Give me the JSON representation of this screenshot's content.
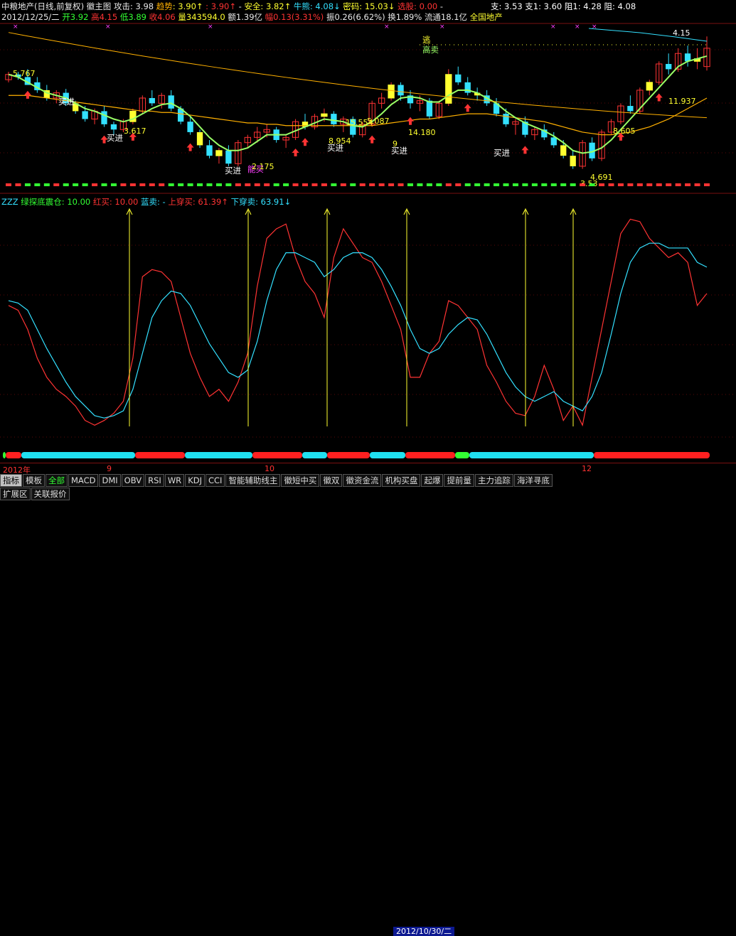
{
  "header": {
    "line1": [
      {
        "t": "中粮地产(日线,前复权)",
        "c": "w"
      },
      {
        "t": " 徽主图 ",
        "c": "w"
      },
      {
        "t": "攻击: 3.98 ",
        "c": "w"
      },
      {
        "t": "趋势",
        "c": "o"
      },
      {
        "t": ": 3.90↑",
        "c": "y"
      },
      {
        "t": " : 3.90↑",
        "c": "r"
      },
      {
        "t": " - ",
        "c": "w"
      },
      {
        "t": "安全: 3.82↑",
        "c": "y"
      },
      {
        "t": " 牛熊: 4.08↓",
        "c": "c"
      },
      {
        "t": " 密码: 15.03↓",
        "c": "y"
      },
      {
        "t": " 选股: 0.00",
        "c": "r"
      },
      {
        "t": " -",
        "c": "w"
      }
    ],
    "line2": [
      {
        "t": "2012/12/25/二 ",
        "c": "w"
      },
      {
        "t": "开3.92 ",
        "c": "g"
      },
      {
        "t": "高4.15 ",
        "c": "r"
      },
      {
        "t": "低3.89 ",
        "c": "g"
      },
      {
        "t": "收4.06 ",
        "c": "r"
      },
      {
        "t": "量343594.0 ",
        "c": "y"
      },
      {
        "t": "额1.39亿 ",
        "c": "w"
      },
      {
        "t": "幅0.13(3.31%) ",
        "c": "r"
      },
      {
        "t": "振0.26(6.62%) ",
        "c": "w"
      },
      {
        "t": "换1.89% ",
        "c": "w"
      },
      {
        "t": "流通18.1亿 ",
        "c": "w"
      },
      {
        "t": "全国地产",
        "c": "y"
      }
    ],
    "right": "支: 3.53 支1: 3.60 阻1: 4.28 阻: 4.08"
  },
  "indicator_header": [
    {
      "t": "ZZZ ",
      "c": "c"
    },
    {
      "t": "绿探底震仓: 10.00 ",
      "c": "g"
    },
    {
      "t": "红买: 10.00 ",
      "c": "r"
    },
    {
      "t": "蓝卖: - ",
      "c": "c"
    },
    {
      "t": "上穿买: 61.39↑ ",
      "c": "r"
    },
    {
      "t": "下穿卖: 63.91↓",
      "c": "c"
    }
  ],
  "annotations": {
    "buy_labels": [
      "买进",
      "买进",
      "买进",
      "买进",
      "买进",
      "买进"
    ],
    "sell_label": "逃",
    "sell_label2": "高卖",
    "weird_label": "能买",
    "price_labels": [
      "5.767",
      "3.617",
      "2.175",
      "8.954",
      "15.554",
      "5.087",
      "14.180",
      "9",
      "4.691",
      "3.53",
      "8.605",
      "11.937",
      "4.15"
    ]
  },
  "date_axis": {
    "labels": [
      "2012年",
      "9",
      "10",
      "12"
    ],
    "cursor_date": "2012/10/30/二"
  },
  "tabs": [
    "指标",
    "模板",
    "全部",
    "MACD",
    "DMI",
    "OBV",
    "RSI",
    "WR",
    "KDJ",
    "CCI",
    "智能辅助线主",
    "徽短中买",
    "徽双",
    "徽资金流",
    "机构买盘",
    "起爆",
    "提前量",
    "主力追踪",
    "海洋寻底"
  ],
  "tabs2": [
    "扩展区",
    "关联报价"
  ],
  "colors": {
    "up": "#ff3333",
    "down": "#33e0ff",
    "bull": "#ffff30",
    "ma_green": "#99ff66",
    "ma_orange": "#ffb000",
    "bg": "#000000"
  },
  "chart_data": [
    {
      "type": "candlestick",
      "title": "中粮地产(日线,前复权)",
      "ohlc": [
        [
          3.82,
          3.88,
          3.8,
          3.86
        ],
        [
          3.86,
          3.88,
          3.82,
          3.84
        ],
        [
          3.84,
          3.9,
          3.8,
          3.78
        ],
        [
          3.8,
          3.84,
          3.72,
          3.74
        ],
        [
          3.74,
          3.78,
          3.66,
          3.68
        ],
        [
          3.68,
          3.74,
          3.64,
          3.72
        ],
        [
          3.72,
          3.75,
          3.62,
          3.64
        ],
        [
          3.64,
          3.66,
          3.56,
          3.58
        ],
        [
          3.58,
          3.62,
          3.5,
          3.52
        ],
        [
          3.52,
          3.6,
          3.48,
          3.58
        ],
        [
          3.58,
          3.62,
          3.46,
          3.48
        ],
        [
          3.48,
          3.5,
          3.4,
          3.44
        ],
        [
          3.44,
          3.52,
          3.42,
          3.5
        ],
        [
          3.5,
          3.6,
          3.48,
          3.58
        ],
        [
          3.58,
          3.7,
          3.56,
          3.68
        ],
        [
          3.68,
          3.74,
          3.62,
          3.64
        ],
        [
          3.64,
          3.72,
          3.6,
          3.7
        ],
        [
          3.7,
          3.74,
          3.58,
          3.6
        ],
        [
          3.6,
          3.62,
          3.48,
          3.5
        ],
        [
          3.5,
          3.54,
          3.4,
          3.42
        ],
        [
          3.42,
          3.44,
          3.3,
          3.32
        ],
        [
          3.32,
          3.36,
          3.22,
          3.24
        ],
        [
          3.24,
          3.3,
          3.18,
          3.28
        ],
        [
          3.28,
          3.32,
          3.16,
          3.18
        ],
        [
          3.18,
          3.36,
          3.16,
          3.34
        ],
        [
          3.34,
          3.4,
          3.3,
          3.38
        ],
        [
          3.38,
          3.46,
          3.34,
          3.42
        ],
        [
          3.42,
          3.48,
          3.38,
          3.44
        ],
        [
          3.44,
          3.46,
          3.34,
          3.36
        ],
        [
          3.36,
          3.4,
          3.3,
          3.38
        ],
        [
          3.38,
          3.52,
          3.36,
          3.5
        ],
        [
          3.5,
          3.56,
          3.44,
          3.46
        ],
        [
          3.46,
          3.56,
          3.44,
          3.54
        ],
        [
          3.54,
          3.6,
          3.5,
          3.56
        ],
        [
          3.56,
          3.58,
          3.46,
          3.48
        ],
        [
          3.48,
          3.54,
          3.42,
          3.52
        ],
        [
          3.52,
          3.54,
          3.38,
          3.4
        ],
        [
          3.4,
          3.5,
          3.38,
          3.48
        ],
        [
          3.48,
          3.66,
          3.46,
          3.64
        ],
        [
          3.64,
          3.72,
          3.6,
          3.68
        ],
        [
          3.68,
          3.8,
          3.66,
          3.78
        ],
        [
          3.78,
          3.8,
          3.66,
          3.7
        ],
        [
          3.7,
          3.74,
          3.6,
          3.64
        ],
        [
          3.64,
          3.7,
          3.58,
          3.66
        ],
        [
          3.66,
          3.68,
          3.52,
          3.54
        ],
        [
          3.54,
          3.66,
          3.52,
          3.64
        ],
        [
          3.64,
          3.9,
          3.62,
          3.86
        ],
        [
          3.86,
          3.92,
          3.78,
          3.8
        ],
        [
          3.8,
          3.84,
          3.7,
          3.72
        ],
        [
          3.72,
          3.76,
          3.66,
          3.7
        ],
        [
          3.7,
          3.74,
          3.62,
          3.64
        ],
        [
          3.64,
          3.68,
          3.54,
          3.56
        ],
        [
          3.56,
          3.6,
          3.46,
          3.48
        ],
        [
          3.48,
          3.52,
          3.4,
          3.5
        ],
        [
          3.5,
          3.54,
          3.38,
          3.4
        ],
        [
          3.4,
          3.46,
          3.36,
          3.44
        ],
        [
          3.44,
          3.48,
          3.36,
          3.38
        ],
        [
          3.38,
          3.42,
          3.3,
          3.32
        ],
        [
          3.32,
          3.36,
          3.22,
          3.24
        ],
        [
          3.24,
          3.28,
          3.14,
          3.16
        ],
        [
          3.16,
          3.36,
          3.14,
          3.34
        ],
        [
          3.34,
          3.38,
          3.2,
          3.22
        ],
        [
          3.22,
          3.44,
          3.2,
          3.42
        ],
        [
          3.42,
          3.52,
          3.4,
          3.5
        ],
        [
          3.5,
          3.64,
          3.48,
          3.62
        ],
        [
          3.62,
          3.7,
          3.56,
          3.58
        ],
        [
          3.58,
          3.76,
          3.56,
          3.74
        ],
        [
          3.74,
          3.82,
          3.7,
          3.8
        ],
        [
          3.8,
          3.96,
          3.78,
          3.94
        ],
        [
          3.94,
          4.02,
          3.86,
          3.9
        ],
        [
          3.9,
          4.06,
          3.88,
          4.02
        ],
        [
          4.02,
          4.08,
          3.92,
          3.96
        ],
        [
          3.96,
          4.06,
          3.9,
          3.98
        ],
        [
          3.92,
          4.15,
          3.89,
          4.06
        ]
      ],
      "ma_fast": [
        3.86,
        3.84,
        3.8,
        3.76,
        3.72,
        3.7,
        3.68,
        3.64,
        3.6,
        3.58,
        3.55,
        3.52,
        3.5,
        3.52,
        3.56,
        3.6,
        3.63,
        3.64,
        3.6,
        3.54,
        3.46,
        3.38,
        3.32,
        3.28,
        3.28,
        3.3,
        3.35,
        3.4,
        3.4,
        3.4,
        3.43,
        3.46,
        3.49,
        3.52,
        3.51,
        3.5,
        3.47,
        3.46,
        3.5,
        3.56,
        3.63,
        3.68,
        3.69,
        3.68,
        3.65,
        3.65,
        3.7,
        3.74,
        3.74,
        3.72,
        3.68,
        3.64,
        3.58,
        3.53,
        3.49,
        3.46,
        3.43,
        3.39,
        3.34,
        3.28,
        3.26,
        3.27,
        3.3,
        3.36,
        3.44,
        3.52,
        3.6,
        3.68,
        3.76,
        3.84,
        3.92,
        3.96,
        3.98,
        4.0
      ],
      "ma_slow": [
        3.7,
        3.7,
        3.7,
        3.69,
        3.68,
        3.67,
        3.66,
        3.65,
        3.64,
        3.63,
        3.62,
        3.61,
        3.6,
        3.59,
        3.58,
        3.58,
        3.57,
        3.57,
        3.56,
        3.55,
        3.54,
        3.53,
        3.52,
        3.51,
        3.5,
        3.49,
        3.49,
        3.48,
        3.48,
        3.47,
        3.47,
        3.47,
        3.47,
        3.47,
        3.47,
        3.47,
        3.47,
        3.47,
        3.47,
        3.48,
        3.49,
        3.5,
        3.51,
        3.52,
        3.52,
        3.53,
        3.54,
        3.55,
        3.56,
        3.56,
        3.56,
        3.55,
        3.54,
        3.53,
        3.52,
        3.51,
        3.5,
        3.48,
        3.46,
        3.44,
        3.42,
        3.41,
        3.4,
        3.4,
        3.41,
        3.42,
        3.44,
        3.46,
        3.49,
        3.52,
        3.56,
        3.6,
        3.64,
        3.68
      ],
      "ylim": [
        3.1,
        4.2
      ]
    },
    {
      "type": "line",
      "title": "ZZZ",
      "series": [
        {
          "name": "红买",
          "color": "#ff3333",
          "values": [
            60,
            58,
            50,
            38,
            30,
            25,
            22,
            18,
            12,
            10,
            12,
            15,
            20,
            38,
            72,
            75,
            74,
            70,
            55,
            40,
            30,
            22,
            25,
            20,
            28,
            40,
            68,
            88,
            92,
            94,
            80,
            70,
            65,
            55,
            80,
            92,
            86,
            80,
            78,
            70,
            60,
            50,
            30,
            30,
            40,
            45,
            62,
            60,
            55,
            50,
            35,
            28,
            20,
            15,
            14,
            22,
            35,
            25,
            12,
            18,
            10,
            30,
            50,
            70,
            90,
            96,
            95,
            88,
            84,
            80,
            82,
            78,
            60,
            65
          ]
        },
        {
          "name": "上穿卖",
          "color": "#33e0ff",
          "values": [
            62,
            61,
            58,
            50,
            42,
            35,
            28,
            22,
            18,
            14,
            13,
            14,
            16,
            25,
            40,
            55,
            62,
            66,
            65,
            60,
            52,
            44,
            38,
            32,
            30,
            33,
            45,
            62,
            75,
            82,
            82,
            80,
            78,
            72,
            75,
            80,
            82,
            82,
            80,
            75,
            68,
            60,
            50,
            42,
            40,
            42,
            48,
            52,
            55,
            54,
            48,
            40,
            32,
            26,
            22,
            20,
            22,
            24,
            20,
            18,
            16,
            22,
            32,
            48,
            65,
            78,
            84,
            86,
            86,
            84,
            84,
            84,
            78,
            76
          ]
        }
      ],
      "ylim": [
        0,
        100
      ]
    }
  ]
}
